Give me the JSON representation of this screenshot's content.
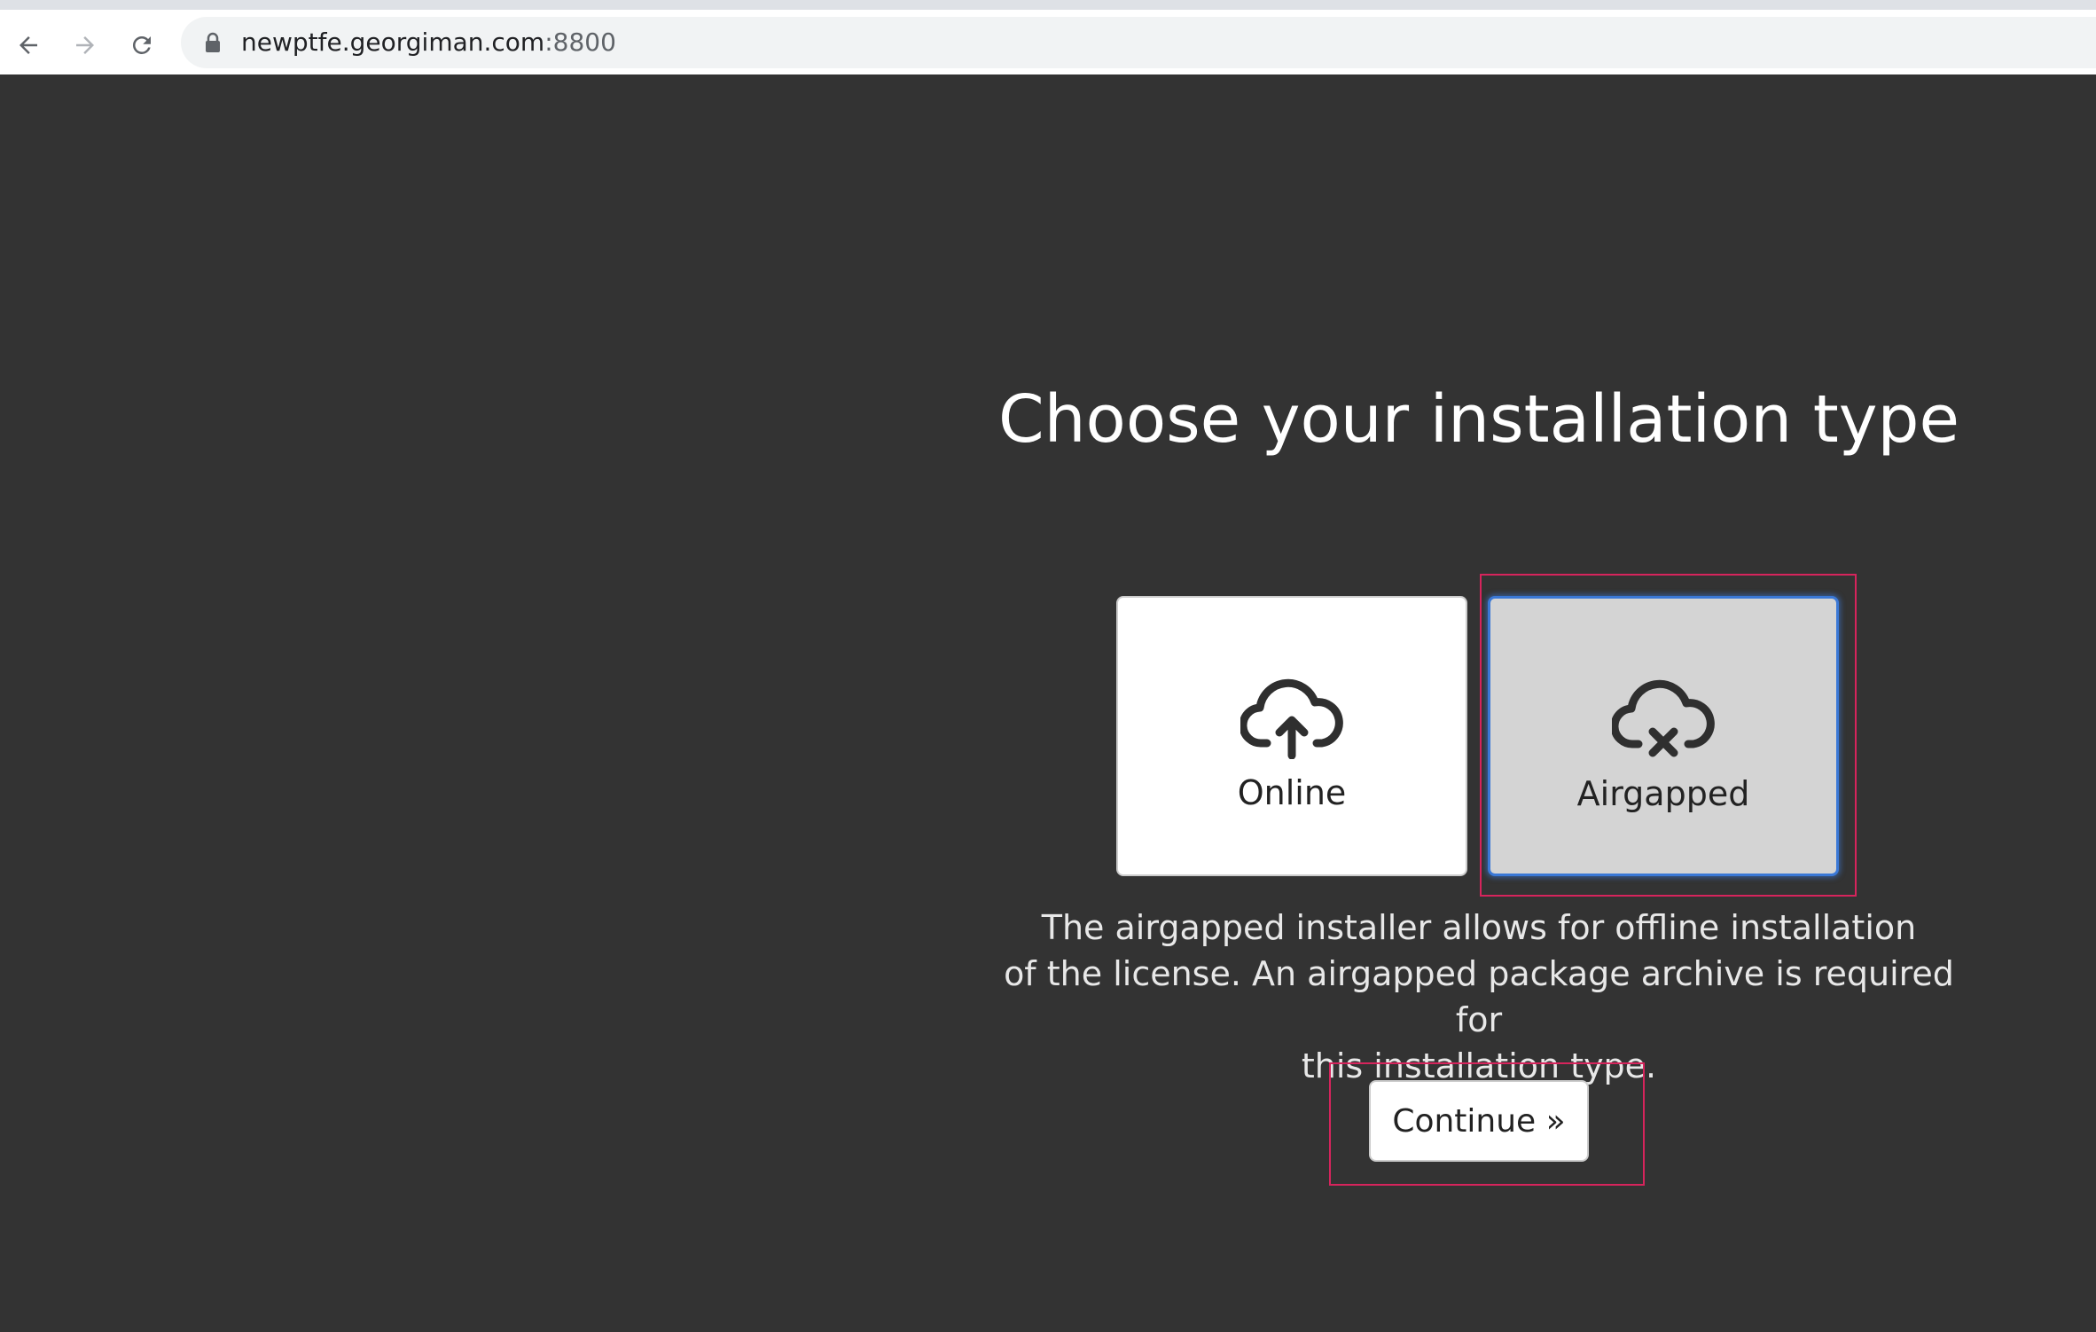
{
  "browser": {
    "url_host": "newptfe.georgiman.com",
    "url_port": ":8800",
    "back_icon": "arrow-left-icon",
    "forward_icon": "arrow-right-icon",
    "reload_icon": "reload-icon",
    "lock_icon": "lock-icon"
  },
  "main": {
    "title": "Choose your installation type",
    "options": [
      {
        "label": "Online",
        "icon": "cloud-upload-icon",
        "selected": false
      },
      {
        "label": "Airgapped",
        "icon": "cloud-x-icon",
        "selected": true
      }
    ],
    "description_lines": [
      "The airgapped installer allows for offline installation",
      "of the license. An airgapped package archive is required for",
      "this installation type."
    ],
    "continue_label": "Continue »"
  },
  "colors": {
    "background": "#333333",
    "selected_card": "#d4d4d4",
    "selected_border": "#3a78d6",
    "highlight": "#d6245c"
  }
}
